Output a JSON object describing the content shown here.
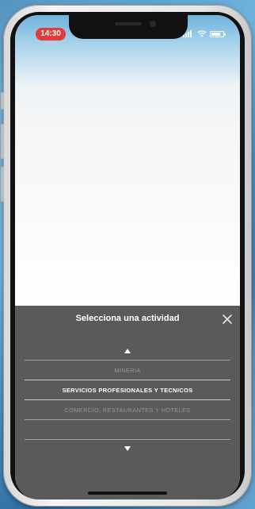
{
  "status_bar": {
    "time": "14:30",
    "battery_level": 0.75
  },
  "picker": {
    "title": "Selecciona una actividad",
    "close_icon": "close-icon",
    "up_icon": "chevron-up-icon",
    "down_icon": "chevron-down-icon",
    "items": [
      {
        "label": "MINERIA",
        "state": "above"
      },
      {
        "label": "SERVICIOS PROFESIONALES Y TECNICOS",
        "state": "selected"
      },
      {
        "label": "COMERCIO, RESTAURANTES Y HOTELES",
        "state": "below"
      },
      {
        "label": "",
        "state": "below-faded"
      }
    ]
  },
  "colors": {
    "picker_bg": "#5a5a5a",
    "time_pill": "#e53a3a"
  }
}
